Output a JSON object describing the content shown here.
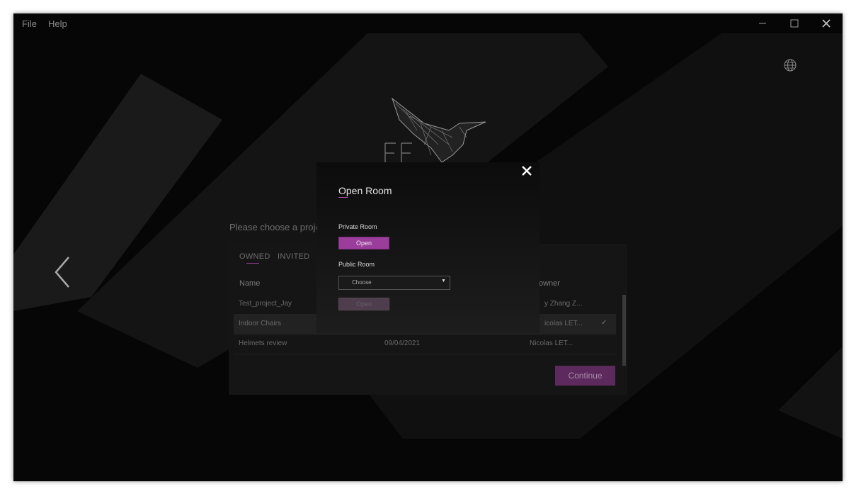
{
  "menubar": {
    "items": [
      "File",
      "Help"
    ]
  },
  "window_controls": {
    "minimize": "minimize-icon",
    "maximize": "maximize-icon",
    "close": "close-icon"
  },
  "background": {
    "prompt": "Please choose a proje",
    "tabs": [
      "OWNED",
      "INVITED"
    ],
    "columns": {
      "name": "Name",
      "owner": "owner"
    },
    "rows": [
      {
        "name": "Test_project_Jay",
        "date": "",
        "owner": "y Zhang Z..."
      },
      {
        "name": "Indoor Chairs",
        "date": "",
        "owner": "icolas LET...",
        "selected": true
      },
      {
        "name": "Helmets review",
        "date": "09/04/2021",
        "owner": "Nicolas LET..."
      }
    ],
    "check_mark": "✓",
    "continue_label": "Continue"
  },
  "modal": {
    "title": "Open Room",
    "private_label": "Private Room",
    "private_open": "Open",
    "public_label": "Public Room",
    "select_value": "Choose",
    "select_arrow": "▼",
    "public_open": "Open"
  },
  "colors": {
    "accent": "#9b3d9b",
    "background": "#060606",
    "panel": "#151515"
  }
}
